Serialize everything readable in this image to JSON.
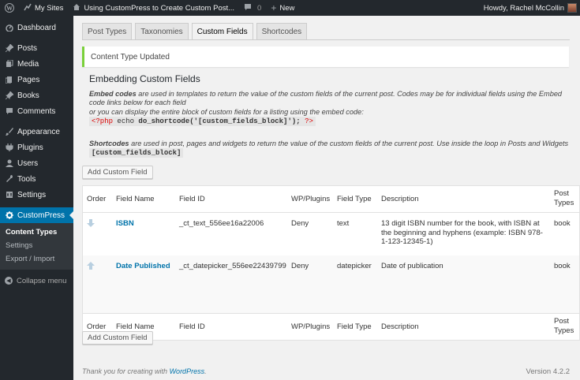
{
  "adminbar": {
    "my_sites": "My Sites",
    "site_title": "Using CustomPress to Create Custom Post...",
    "comments": "0",
    "new": "New",
    "howdy": "Howdy, Rachel McCollin"
  },
  "sidebar": {
    "items": [
      {
        "label": "Dashboard",
        "icon": "dashboard-icon"
      },
      {
        "label": "Posts",
        "icon": "pin-icon"
      },
      {
        "label": "Media",
        "icon": "media-icon"
      },
      {
        "label": "Pages",
        "icon": "page-icon"
      },
      {
        "label": "Books",
        "icon": "pin-icon"
      },
      {
        "label": "Comments",
        "icon": "comment-icon"
      },
      {
        "label": "Appearance",
        "icon": "brush-icon"
      },
      {
        "label": "Plugins",
        "icon": "plug-icon"
      },
      {
        "label": "Users",
        "icon": "user-icon"
      },
      {
        "label": "Tools",
        "icon": "wrench-icon"
      },
      {
        "label": "Settings",
        "icon": "settings-icon"
      }
    ],
    "current": "CustomPress",
    "submenu": [
      "Content Types",
      "Settings",
      "Export / Import"
    ],
    "collapse": "Collapse menu"
  },
  "tabs": [
    "Post Types",
    "Taxonomies",
    "Custom Fields",
    "Shortcodes"
  ],
  "notice": "Content Type Updated",
  "section_title": "Embedding Custom Fields",
  "embed": {
    "em1": "Embed codes",
    "text1": " are used in templates to return the value of the custom fields of the current post. Codes may be for individual fields using the Embed code links below for each field",
    "text2": "or you can display the entire block of custom fields for a listing using the embed code:",
    "code_open": "<?php",
    "code_echo": " echo ",
    "code_func": "do_shortcode('[custom_fields_block]');",
    "code_close": "?>"
  },
  "shortcodes": {
    "em": "Shortcodes",
    "text": " are used in post, pages and widgets to return the value of the custom fields of the current post. Use inside the loop in Posts and Widgets",
    "code": "[custom_fields_block]"
  },
  "add_button": "Add Custom Field",
  "table": {
    "headers": {
      "order": "Order",
      "name": "Field Name",
      "id": "Field ID",
      "wp": "WP/Plugins",
      "type": "Field Type",
      "desc": "Description",
      "post": "Post Types"
    },
    "rows": [
      {
        "name": "ISBN",
        "id": "_ct_text_556ee16a22006",
        "wp": "Deny",
        "type": "text",
        "desc": "13 digit ISBN number for the book, with ISBN at the beginning and hyphens (example: ISBN 978-1-123-12345-1)",
        "post": "book"
      },
      {
        "name": "Date Published",
        "id": "_ct_datepicker_556ee22439799",
        "wp": "Deny",
        "type": "datepicker",
        "desc": "Date of publication",
        "post": "book"
      }
    ]
  },
  "footer": {
    "thanks_prefix": "Thank you for creating with ",
    "wp_link": "WordPress",
    "thanks_suffix": ".",
    "version": "Version 4.2.2"
  },
  "colors": {
    "admin_dark": "#23282d",
    "accent": "#0073aa",
    "notice_green": "#7ad03a"
  }
}
